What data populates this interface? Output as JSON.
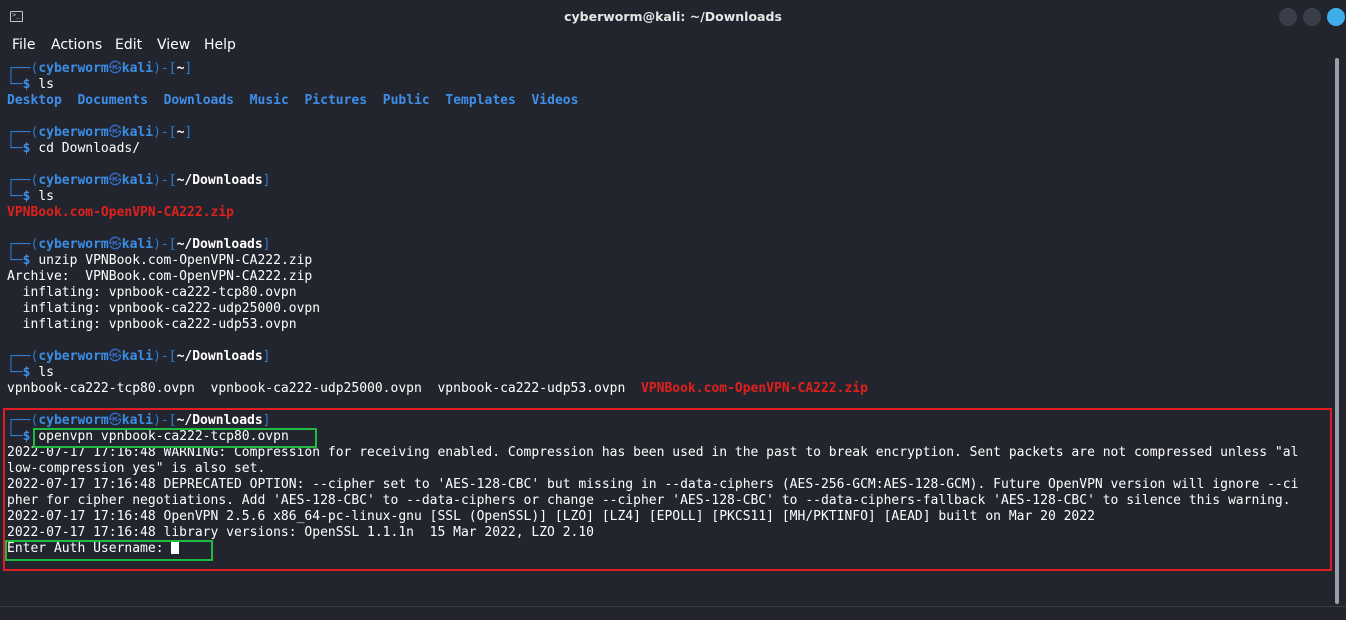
{
  "window": {
    "title": "cyberworm@kali: ~/Downloads",
    "app_icon": "terminal-icon"
  },
  "menu": {
    "items": [
      "File",
      "Actions",
      "Edit",
      "View",
      "Help"
    ]
  },
  "prompt": {
    "user": "cyberworm",
    "skull": "㉿",
    "host": "kali",
    "top_left": "┌──(",
    "host_close": ")-[",
    "bracket_close": "]",
    "bottom_left": "└─",
    "dollar": "$"
  },
  "terminal": {
    "block1": {
      "cwd": "~",
      "command": "ls",
      "output_dirs": [
        "Desktop",
        "Documents",
        "Downloads",
        "Music",
        "Pictures",
        "Public",
        "Templates",
        "Videos"
      ]
    },
    "block2": {
      "cwd": "~",
      "command": "cd Downloads/"
    },
    "block3": {
      "cwd": "~/Downloads",
      "command": "ls",
      "output_file": "VPNBook.com-OpenVPN-CA222.zip"
    },
    "block4": {
      "cwd": "~/Downloads",
      "command": "unzip VPNBook.com-OpenVPN-CA222.zip",
      "output": [
        "Archive:  VPNBook.com-OpenVPN-CA222.zip",
        "  inflating: vpnbook-ca222-tcp80.ovpn",
        "  inflating: vpnbook-ca222-udp25000.ovpn",
        "  inflating: vpnbook-ca222-udp53.ovpn"
      ]
    },
    "block5": {
      "cwd": "~/Downloads",
      "command": "ls",
      "files_plain": "vpnbook-ca222-tcp80.ovpn  vpnbook-ca222-udp25000.ovpn  vpnbook-ca222-udp53.ovpn  ",
      "file_red": "VPNBook.com-OpenVPN-CA222.zip"
    },
    "block6": {
      "cwd": "~/Downloads",
      "command": "openvpn vpnbook-ca222-tcp80.ovpn",
      "output": [
        "2022-07-17 17:16:48 WARNING: Compression for receiving enabled. Compression has been used in the past to break encryption. Sent packets are not compressed unless \"al",
        "low-compression yes\" is also set.",
        "2022-07-17 17:16:48 DEPRECATED OPTION: --cipher set to 'AES-128-CBC' but missing in --data-ciphers (AES-256-GCM:AES-128-GCM). Future OpenVPN version will ignore --ci",
        "pher for cipher negotiations. Add 'AES-128-CBC' to --data-ciphers or change --cipher 'AES-128-CBC' to --data-ciphers-fallback 'AES-128-CBC' to silence this warning.",
        "2022-07-17 17:16:48 OpenVPN 2.5.6 x86_64-pc-linux-gnu [SSL (OpenSSL)] [LZO] [LZ4] [EPOLL] [PKCS11] [MH/PKTINFO] [AEAD] built on Mar 20 2022",
        "2022-07-17 17:16:48 library versions: OpenSSL 1.1.1n  15 Mar 2022, LZO 2.10"
      ],
      "auth_prompt": "Enter Auth Username: "
    }
  },
  "colors": {
    "background": "#23252e",
    "prompt_blue": "#2f7dcf",
    "dir_blue": "#3e8ee8",
    "archive_red": "#e0201c",
    "highlight_red": "#e01c24",
    "highlight_green": "#1fba3f",
    "close_button": "#3daee9"
  }
}
